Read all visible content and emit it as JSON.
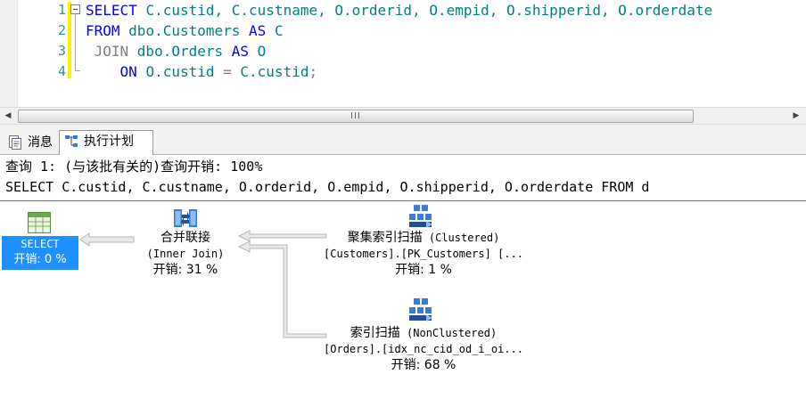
{
  "editor": {
    "line_numbers": [
      "1",
      "2",
      "3",
      "4"
    ],
    "lines": [
      [
        {
          "t": "SELECT ",
          "c": "kw"
        },
        {
          "t": "C.custid, C.custname, O.orderid, O.empid, O.shipperid, O.orderdate",
          "c": "tx"
        }
      ],
      [
        {
          "t": "FROM ",
          "c": "kw"
        },
        {
          "t": "dbo.Customers ",
          "c": "tx"
        },
        {
          "t": "AS ",
          "c": "kw"
        },
        {
          "t": "C",
          "c": "tx"
        }
      ],
      [
        {
          "t": " JOIN ",
          "c": "gr"
        },
        {
          "t": "dbo.Orders ",
          "c": "tx"
        },
        {
          "t": "AS ",
          "c": "kw"
        },
        {
          "t": "O",
          "c": "tx"
        }
      ],
      [
        {
          "t": "    ON ",
          "c": "kw"
        },
        {
          "t": "O.custid ",
          "c": "tx"
        },
        {
          "t": "= ",
          "c": "gr"
        },
        {
          "t": "C.custid",
          "c": "tx"
        },
        {
          "t": ";",
          "c": "gr"
        }
      ]
    ],
    "colors": {
      "keyword": "#0000ff",
      "operator": "#808080",
      "identifier": "#008080",
      "line_number": "#2b91af"
    }
  },
  "scrollbar": {
    "left_arrow": "◀",
    "right_arrow": "▶",
    "grip": "III"
  },
  "tabs": [
    {
      "label": "消息",
      "icon": "messages-icon"
    },
    {
      "label": "执行计划",
      "icon": "execution-plan-icon",
      "active": true
    }
  ],
  "query_header": {
    "line1": "查询 1: (与该批有关的)查询开销: 100%",
    "line2": "SELECT C.custid, C.custname, O.orderid, O.empid, O.shipperid, O.orderdate FROM d"
  },
  "plan": {
    "select": {
      "label": "SELECT",
      "cost": "开销: 0 %",
      "icon": "select-icon"
    },
    "merge_join": {
      "name": "合并联接",
      "detail": "(Inner Join)",
      "cost": "开销: 31 %",
      "icon": "merge-join-icon"
    },
    "clustered_scan": {
      "name": "聚集索引扫描",
      "type": "(Clustered)",
      "object": "[Customers].[PK_Customers] [...",
      "cost": "开销: 1 %",
      "icon": "clustered-index-scan-icon"
    },
    "index_scan": {
      "name": "索引扫描",
      "type": "(NonClustered)",
      "object": "[Orders].[idx_nc_cid_od_i_oi...",
      "cost": "开销: 68 %",
      "icon": "index-scan-icon"
    },
    "colors": {
      "selected": "#1e90ff",
      "arrow": "#c8c8c8"
    }
  }
}
